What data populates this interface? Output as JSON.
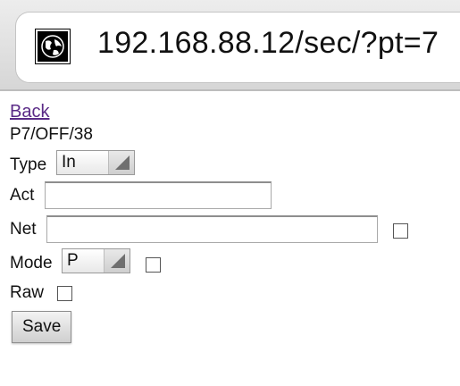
{
  "browser": {
    "url": "192.168.88.12/sec/?pt=7",
    "site_icon": "globe-icon"
  },
  "page": {
    "back_link": "Back",
    "status": "P7/OFF/38",
    "type_label": "Type",
    "type_value": "In",
    "act_label": "Act",
    "act_value": "",
    "net_label": "Net",
    "net_value": "",
    "net_checked": false,
    "mode_label": "Mode",
    "mode_value": "P",
    "mode_checked": false,
    "raw_label": "Raw",
    "raw_checked": false,
    "save_label": "Save"
  },
  "colors": {
    "link": "#5a2a86",
    "toolbar": "#dcdcdc"
  }
}
